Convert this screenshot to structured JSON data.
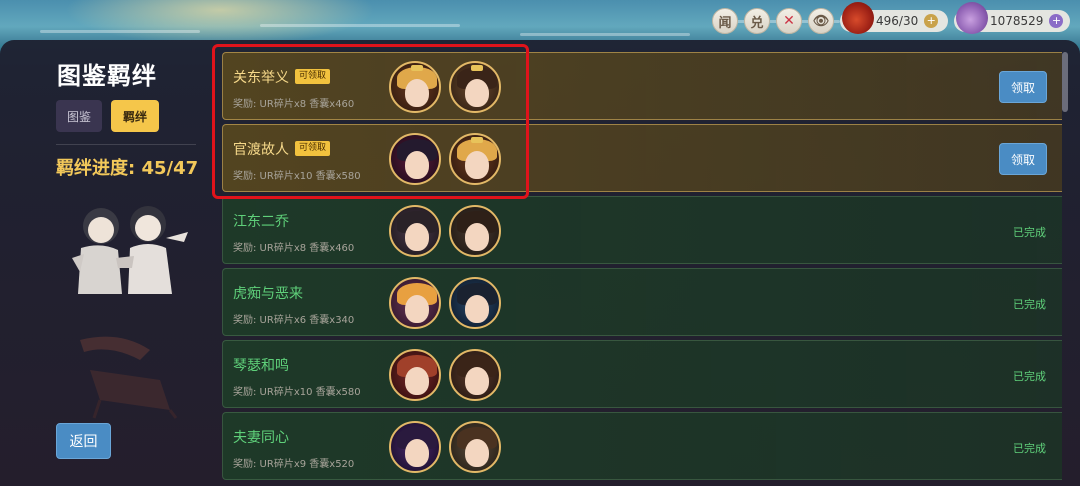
{
  "topbar": {
    "btn_news": "闻",
    "btn_exchange": "兑",
    "btn_close": "✕",
    "btn_eye": "👁",
    "stamina": "496/30",
    "currency": "1078529",
    "plus": "+"
  },
  "left": {
    "title": "图鉴羁绊",
    "tab_album": "图鉴",
    "tab_bond": "羁绊",
    "progress": "羁绊进度: 45/47",
    "back": "返回"
  },
  "rows": [
    {
      "name": "关东举义",
      "badge": "可领取",
      "reward": "奖励: UR碎片x8  香囊x460",
      "status": "pending",
      "action": "领取"
    },
    {
      "name": "官渡故人",
      "badge": "可领取",
      "reward": "奖励: UR碎片x10  香囊x580",
      "status": "pending",
      "action": "领取"
    },
    {
      "name": "江东二乔",
      "reward": "奖励: UR碎片x8  香囊x460",
      "status": "done",
      "action": "已完成"
    },
    {
      "name": "虎痴与恶来",
      "reward": "奖励: UR碎片x6  香囊x340",
      "status": "done",
      "action": "已完成"
    },
    {
      "name": "琴瑟和鸣",
      "reward": "奖励: UR碎片x10  香囊x580",
      "status": "done",
      "action": "已完成"
    },
    {
      "name": "夫妻同心",
      "reward": "奖励: UR碎片x9  香囊x520",
      "status": "done",
      "action": "已完成"
    }
  ],
  "colors": {
    "accent_gold": "#f5c64a",
    "button_blue": "#4a8cc4",
    "done_green": "#5fd07a",
    "highlight_red": "#e0131b"
  }
}
